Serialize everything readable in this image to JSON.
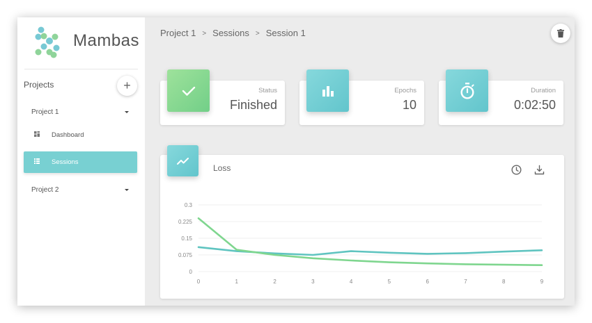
{
  "app": {
    "brand": "Mambas"
  },
  "sidebar": {
    "projects_label": "Projects",
    "add_icon": "plus-icon",
    "projects": [
      {
        "label": "Project 1",
        "expanded": true
      },
      {
        "label": "Project 2",
        "expanded": false
      }
    ],
    "nav": [
      {
        "label": "Dashboard",
        "icon": "dashboard-icon",
        "active": false
      },
      {
        "label": "Sessions",
        "icon": "list-icon",
        "active": true
      }
    ]
  },
  "breadcrumb": {
    "items": [
      "Project 1",
      "Sessions",
      "Session 1"
    ],
    "separator": ">"
  },
  "header": {
    "delete_icon": "trash-icon"
  },
  "stats": [
    {
      "label": "Status",
      "value": "Finished",
      "icon": "check-icon",
      "color": "#7fd68f"
    },
    {
      "label": "Epochs",
      "value": "10",
      "icon": "bar-chart-icon",
      "color": "#6ccdd2"
    },
    {
      "label": "Duration",
      "value": "0:02:50",
      "icon": "stopwatch-icon",
      "color": "#6ccdd2"
    }
  ],
  "loss_card": {
    "title": "Loss",
    "icon": "trending-icon",
    "tools": [
      "history-icon",
      "download-icon"
    ]
  },
  "colors": {
    "accent": "#78d0d2",
    "green": "#7fd68f",
    "teal_line": "#5fc4c0",
    "green_line": "#7fd68f"
  },
  "chart_data": {
    "type": "line",
    "x": [
      0,
      1,
      2,
      3,
      4,
      5,
      6,
      7,
      8,
      9
    ],
    "series": [
      {
        "values": [
          0.11,
          0.092,
          0.082,
          0.075,
          0.092,
          0.085,
          0.08,
          0.083,
          0.09,
          0.096
        ],
        "color": "#5fc4c0"
      },
      {
        "values": [
          0.24,
          0.098,
          0.075,
          0.06,
          0.05,
          0.042,
          0.037,
          0.033,
          0.031,
          0.029
        ],
        "color": "#7fd68f"
      }
    ],
    "ylim": [
      0,
      0.3
    ],
    "yticks": [
      "0",
      "0.075",
      "0.15",
      "0.225",
      "0.3"
    ],
    "xticks": [
      "0",
      "1",
      "2",
      "3",
      "4",
      "5",
      "6",
      "7",
      "8",
      "9"
    ],
    "grid": true
  }
}
